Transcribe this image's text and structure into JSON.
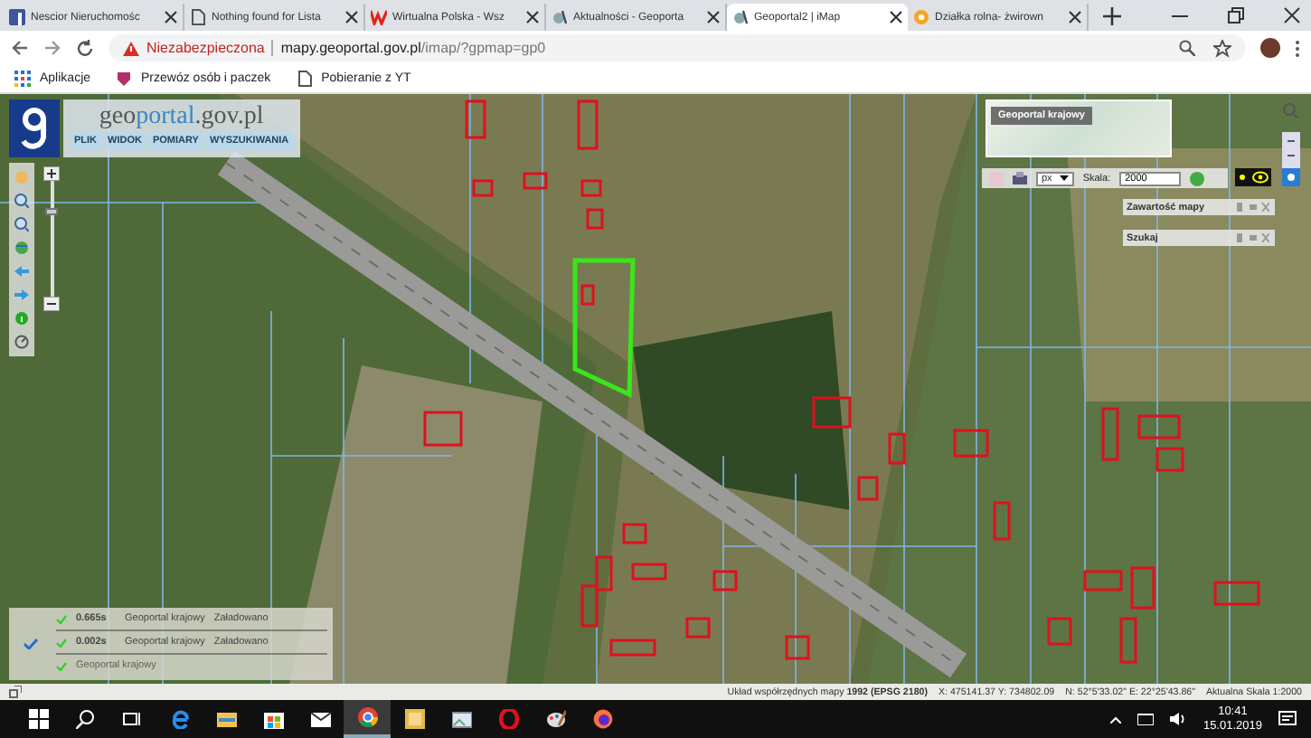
{
  "browser": {
    "tabs": [
      {
        "kind": "facebook",
        "title": "Nescior Nieruchomośc",
        "selected": false
      },
      {
        "kind": "page",
        "title": "Nothing found for Lista",
        "selected": false
      },
      {
        "kind": "wp",
        "title": "Wirtualna Polska - Wsz",
        "selected": false
      },
      {
        "kind": "geoportal",
        "title": "Aktualności - Geoporta",
        "selected": false
      },
      {
        "kind": "geoportal",
        "title": "Geoportal2 | iMap",
        "selected": true
      },
      {
        "kind": "olx",
        "title": "Działka rolna- żwirown",
        "selected": false
      }
    ],
    "address": {
      "warning": "Niezabezpieczona",
      "host": "mapy.geoportal.gov.pl",
      "path": "/imap/?gpmap=gp0"
    },
    "bookmarks": [
      {
        "kind": "apps",
        "label": "Aplikacje"
      },
      {
        "kind": "shield",
        "label": "Przewóz osób i paczek"
      },
      {
        "kind": "page",
        "label": "Pobieranie z YT"
      }
    ]
  },
  "app": {
    "logo": {
      "prefix": "geo",
      "brand": "portal",
      "suffix": ".gov.pl"
    },
    "zoom_slider": {
      "level": 0.75
    },
    "menu": [
      "PLIK",
      "WIDOK",
      "POMIARY",
      "WYSZUKIWANIA"
    ],
    "overview_title": "Geoportal krajowy",
    "toolbar": {
      "unit": "px",
      "scale_label": "Skala:",
      "scale_value": "2000"
    },
    "panels": [
      {
        "title": "Zawartość mapy"
      },
      {
        "title": "Szukaj"
      }
    ],
    "log": [
      {
        "time": "0.665s",
        "source": "Geoportal krajowy",
        "status": "Załadowano",
        "faded": false
      },
      {
        "time": "0.002s",
        "source": "Geoportal krajowy",
        "status": "Załadowano",
        "faded": false
      },
      {
        "source": "Geoportal krajowy",
        "faded": true
      }
    ],
    "status_bar": {
      "label": "Układ współrzędnych mapy",
      "crs": "1992 (EPSG 2180)",
      "xy": "X: 475141.37 Y: 734802.09",
      "geo": "N: 52°5'33.02\" E: 22°25'43.86\"",
      "scale": "Aktualna Skala 1:2000"
    }
  },
  "taskbar": {
    "apps": [
      {
        "kind": "start",
        "selected": false
      },
      {
        "kind": "search",
        "selected": false
      },
      {
        "kind": "taskview",
        "selected": false
      },
      {
        "kind": "edge",
        "selected": false
      },
      {
        "kind": "folder",
        "selected": false
      },
      {
        "kind": "store",
        "selected": false
      },
      {
        "kind": "mail",
        "selected": false
      },
      {
        "kind": "chrome",
        "selected": true
      },
      {
        "kind": "note",
        "selected": false
      },
      {
        "kind": "photos",
        "selected": false
      },
      {
        "kind": "opera",
        "selected": false
      },
      {
        "kind": "paint",
        "selected": false
      },
      {
        "kind": "firefox",
        "selected": false
      }
    ],
    "time": "10:41",
    "date": "15.01.2019"
  }
}
